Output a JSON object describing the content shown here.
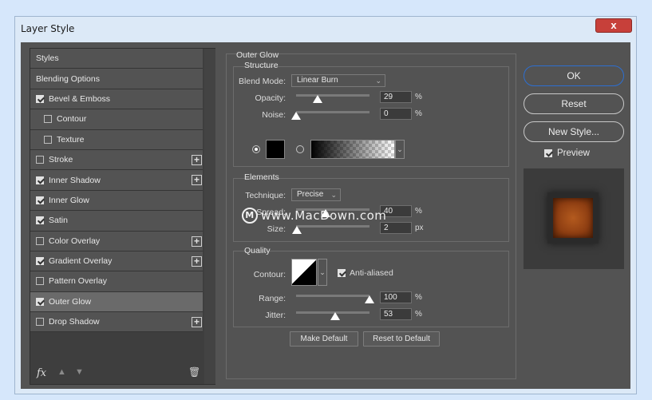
{
  "window": {
    "title": "Layer Style",
    "close_glyph": "x"
  },
  "styles_panel": {
    "header_items": [
      "Styles",
      "Blending Options"
    ],
    "items": [
      {
        "label": "Bevel & Emboss",
        "checked": true,
        "plus": false,
        "indent": false
      },
      {
        "label": "Contour",
        "checked": false,
        "plus": false,
        "indent": true
      },
      {
        "label": "Texture",
        "checked": false,
        "plus": false,
        "indent": true
      },
      {
        "label": "Stroke",
        "checked": false,
        "plus": true,
        "indent": false
      },
      {
        "label": "Inner Shadow",
        "checked": true,
        "plus": true,
        "indent": false
      },
      {
        "label": "Inner Glow",
        "checked": true,
        "plus": false,
        "indent": false
      },
      {
        "label": "Satin",
        "checked": true,
        "plus": false,
        "indent": false
      },
      {
        "label": "Color Overlay",
        "checked": false,
        "plus": true,
        "indent": false
      },
      {
        "label": "Gradient Overlay",
        "checked": true,
        "plus": true,
        "indent": false
      },
      {
        "label": "Pattern Overlay",
        "checked": false,
        "plus": false,
        "indent": false
      },
      {
        "label": "Outer Glow",
        "checked": true,
        "plus": false,
        "indent": false,
        "selected": true
      },
      {
        "label": "Drop Shadow",
        "checked": false,
        "plus": true,
        "indent": false
      }
    ],
    "fx_label": "fx",
    "icons": [
      "fx-icon",
      "move-up-icon",
      "move-down-icon",
      "trash-icon"
    ]
  },
  "outer_glow": {
    "title": "Outer Glow",
    "structure": {
      "title": "Structure",
      "blend_mode_label": "Blend Mode:",
      "blend_mode_value": "Linear Burn",
      "opacity_label": "Opacity:",
      "opacity_value": "29",
      "opacity_unit": "%",
      "opacity_fraction": 0.29,
      "noise_label": "Noise:",
      "noise_value": "0",
      "noise_unit": "%",
      "noise_fraction": 0.0,
      "color_mode": "solid",
      "color_swatch": "#000000"
    },
    "elements": {
      "title": "Elements",
      "technique_label": "Technique:",
      "technique_value": "Precise",
      "spread_label": "Spread:",
      "spread_value": "40",
      "spread_unit": "%",
      "spread_fraction": 0.4,
      "size_label": "Size:",
      "size_value": "2",
      "size_unit": "px",
      "size_fraction": 0.01
    },
    "quality": {
      "title": "Quality",
      "contour_label": "Contour:",
      "anti_aliased_label": "Anti-aliased",
      "anti_aliased": true,
      "range_label": "Range:",
      "range_value": "100",
      "range_unit": "%",
      "range_fraction": 1.0,
      "jitter_label": "Jitter:",
      "jitter_value": "53",
      "jitter_unit": "%",
      "jitter_fraction": 0.53
    },
    "make_default_label": "Make Default",
    "reset_default_label": "Reset to Default"
  },
  "actions": {
    "ok_label": "OK",
    "reset_label": "Reset",
    "new_style_label": "New Style...",
    "preview_label": "Preview",
    "preview_checked": true
  },
  "watermark": {
    "text": "www.MacDown.com",
    "logo_letter": "M"
  }
}
